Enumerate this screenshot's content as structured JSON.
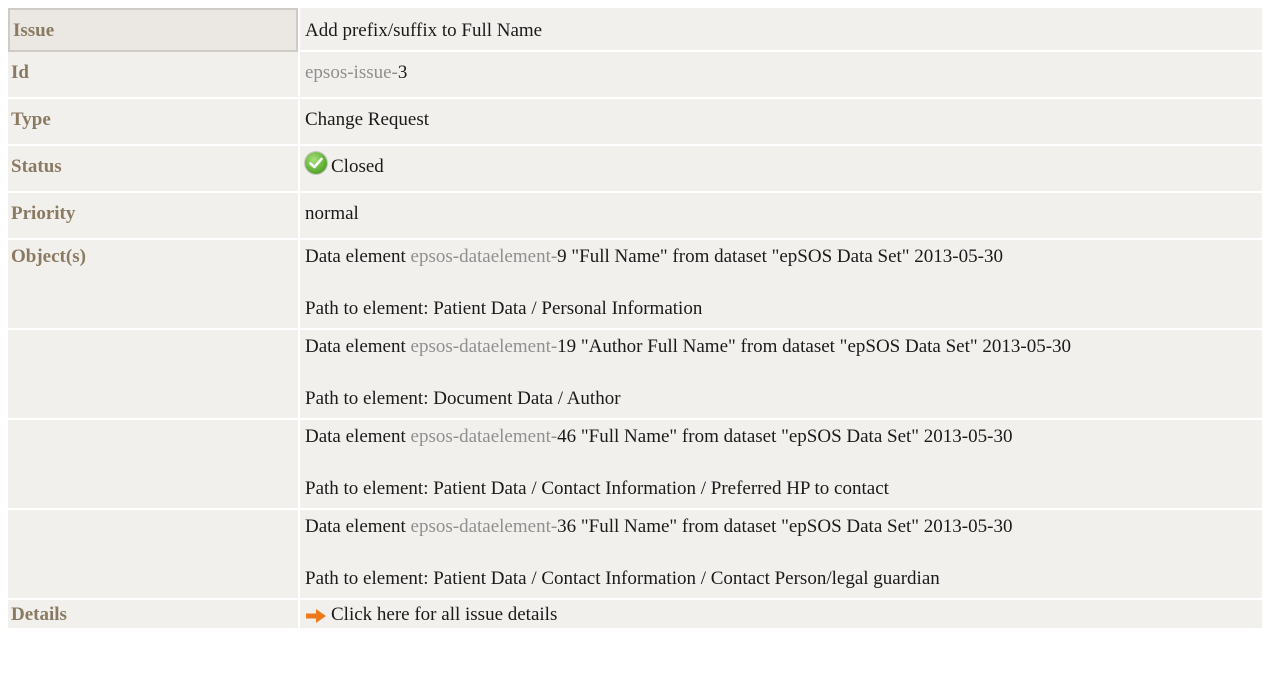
{
  "issue": {
    "label": "Issue",
    "title": "Add prefix/suffix to Full Name"
  },
  "id": {
    "label": "Id",
    "prefix": "epsos-issue-",
    "number": "3"
  },
  "type": {
    "label": "Type",
    "value": "Change Request"
  },
  "status": {
    "label": "Status",
    "icon": "check-circle-icon",
    "value": "Closed",
    "color": "#55a62a"
  },
  "priority": {
    "label": "Priority",
    "value": "normal"
  },
  "objects": {
    "label": "Object(s)",
    "items": [
      {
        "pre": "Data element ",
        "ref_prefix": "epsos-dataelement-",
        "ref_number": "9",
        "post": " \"Full Name\" from dataset \"epSOS Data Set\" 2013-05-30",
        "path": "Path to element: Patient Data / Personal Information"
      },
      {
        "pre": "Data element ",
        "ref_prefix": "epsos-dataelement-",
        "ref_number": "19",
        "post": " \"Author Full Name\" from dataset \"epSOS Data Set\" 2013-05-30",
        "path": "Path to element: Document Data / Author"
      },
      {
        "pre": "Data element ",
        "ref_prefix": "epsos-dataelement-",
        "ref_number": "46",
        "post": " \"Full Name\" from dataset \"epSOS Data Set\" 2013-05-30",
        "path": "Path to element: Patient Data / Contact Information / Preferred HP to contact"
      },
      {
        "pre": "Data element ",
        "ref_prefix": "epsos-dataelement-",
        "ref_number": "36",
        "post": " \"Full Name\" from dataset \"epSOS Data Set\" 2013-05-30",
        "path": "Path to element: Patient Data / Contact Information / Contact Person/legal guardian"
      }
    ]
  },
  "details": {
    "label": "Details",
    "icon": "arrow-right-icon",
    "link_text": "Click here for all issue details",
    "icon_color": "#f07a1a"
  }
}
